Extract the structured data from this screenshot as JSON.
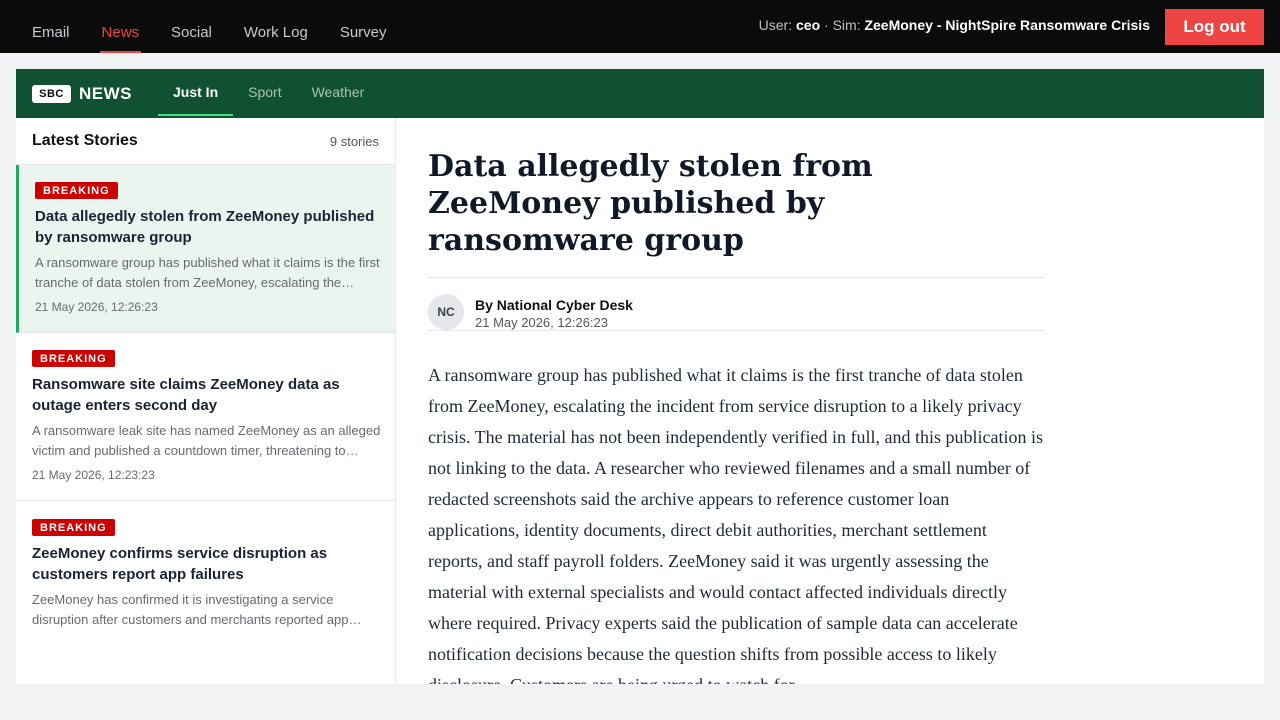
{
  "topbar": {
    "tabs": [
      "Email",
      "News",
      "Social",
      "Work Log",
      "Survey"
    ],
    "active_tab": "News",
    "user_label": "User:",
    "user": "ceo",
    "sim_label": "Sim:",
    "sim": "ZeeMoney - NightSpire Ransomware Crisis",
    "logout": "Log out"
  },
  "news": {
    "logo": "SBC",
    "brand": "NEWS",
    "tabs": [
      "Just In",
      "Sport",
      "Weather"
    ],
    "active_tab": "Just In"
  },
  "sidebar": {
    "title": "Latest Stories",
    "count": "9 stories",
    "stories": [
      {
        "badge": "BREAKING",
        "title": "Data allegedly stolen from ZeeMoney published by ransomware group",
        "summary": "A ransomware group has published what it claims is the first tranche of data stolen from ZeeMoney, escalating the incident from service disruption to a likely privacy crisis.",
        "date": "21 May 2026, 12:26:23"
      },
      {
        "badge": "BREAKING",
        "title": "Ransomware site claims ZeeMoney data as outage enters second day",
        "summary": "A ransomware leak site has named ZeeMoney as an alleged victim and published a countdown timer, threatening to release data.",
        "date": "21 May 2026, 12:23:23"
      },
      {
        "badge": "BREAKING",
        "title": "ZeeMoney confirms service disruption as customers report app failures",
        "summary": "ZeeMoney has confirmed it is investigating a service disruption after customers and merchants reported app failures.",
        "date": ""
      }
    ]
  },
  "article": {
    "title": "Data allegedly stolen from ZeeMoney published by ransomware group",
    "avatar": "NC",
    "author": "By National Cyber Desk",
    "date": "21 May 2026, 12:26:23",
    "body": "A ransomware group has published what it claims is the first tranche of data stolen from ZeeMoney, escalating the incident from service disruption to a likely privacy crisis. The material has not been independently verified in full, and this publication is not linking to the data. A researcher who reviewed filenames and a small number of redacted screenshots said the archive appears to reference customer loan applications, identity documents, direct debit authorities, merchant settlement reports, and staff payroll folders. ZeeMoney said it was urgently assessing the material with external specialists and would contact affected individuals directly where required. Privacy experts said the publication of sample data can accelerate notification decisions because the question shifts from possible access to likely disclosure. Customers are being urged to watch for"
  }
}
